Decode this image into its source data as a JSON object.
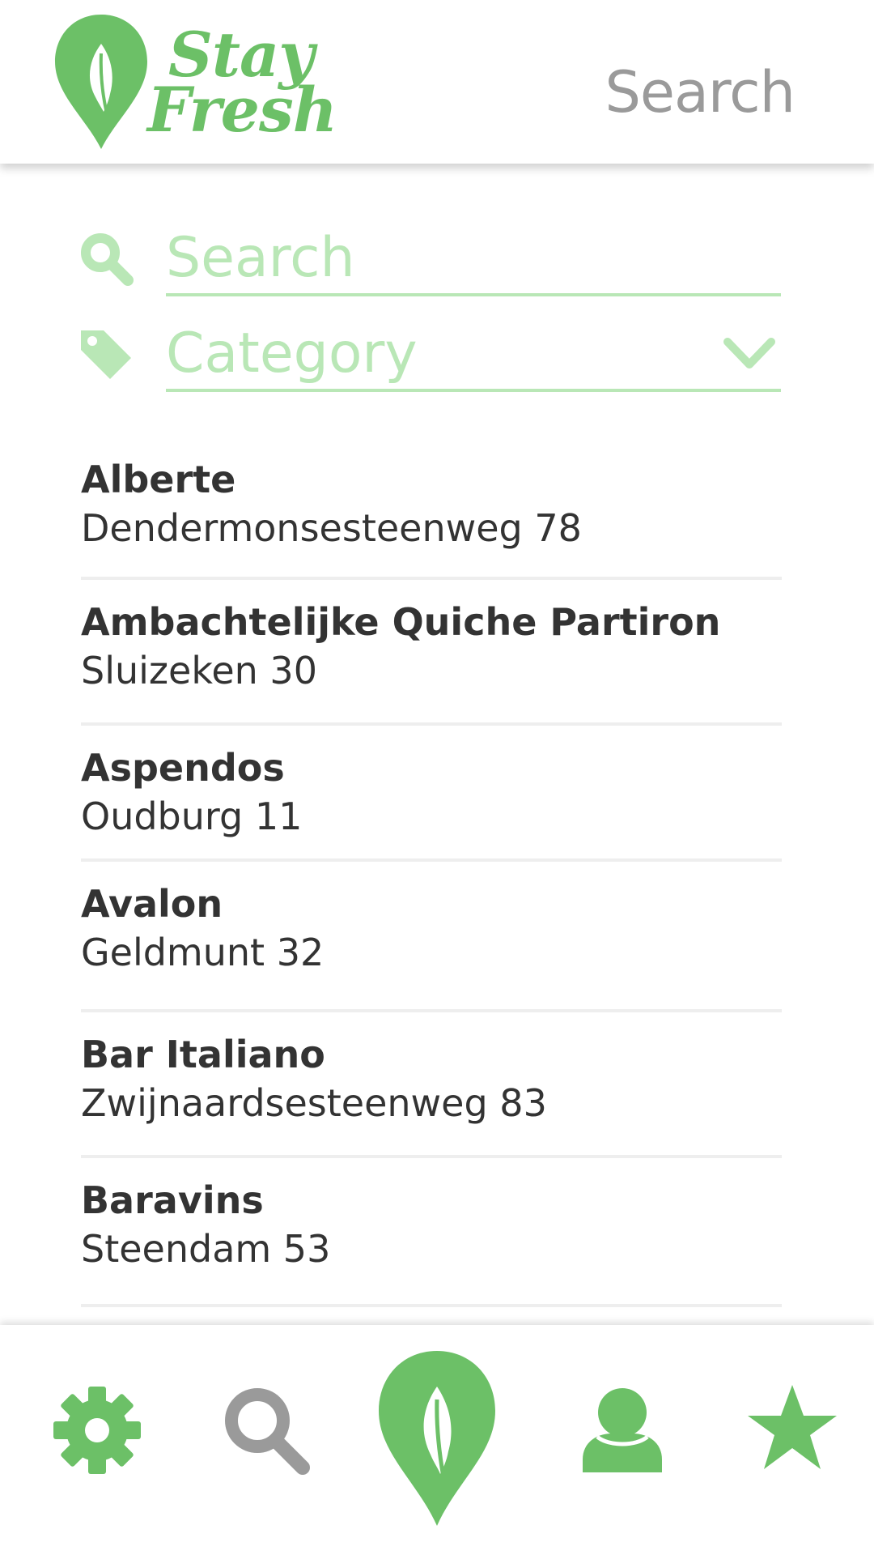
{
  "colors": {
    "brand_green": "#6cc067",
    "light_green": "#b9e7b6",
    "grey_text": "#9a9a9a",
    "dark_text": "#333333",
    "divider": "#eeeeee"
  },
  "header": {
    "logo": {
      "line1": "Stay",
      "line2": "Fresh",
      "icon": "leaf-pin-icon"
    },
    "search_link": "Search"
  },
  "filters": {
    "search": {
      "placeholder": "Search",
      "value": "",
      "icon": "search-icon"
    },
    "category": {
      "placeholder": "Category",
      "icon": "tag-icon",
      "dropdown_icon": "chevron-down-icon"
    }
  },
  "restaurants": [
    {
      "name": "Alberte",
      "address": "Dendermonsesteenweg 78"
    },
    {
      "name": "Ambachtelijke Quiche Partiron",
      "address": "Sluizeken 30"
    },
    {
      "name": "Aspendos",
      "address": "Oudburg 11"
    },
    {
      "name": "Avalon",
      "address": "Geldmunt 32"
    },
    {
      "name": "Bar Italiano",
      "address": "Zwijnaardsesteenweg 83"
    },
    {
      "name": "Baravins",
      "address": "Steendam 53"
    }
  ],
  "bottom_nav": [
    {
      "id": "settings",
      "icon": "gear-icon",
      "active": false
    },
    {
      "id": "search",
      "icon": "search-icon",
      "active": true
    },
    {
      "id": "home",
      "icon": "leaf-pin-icon",
      "active": false
    },
    {
      "id": "profile",
      "icon": "user-icon",
      "active": false
    },
    {
      "id": "favorites",
      "icon": "star-icon",
      "active": false
    }
  ]
}
